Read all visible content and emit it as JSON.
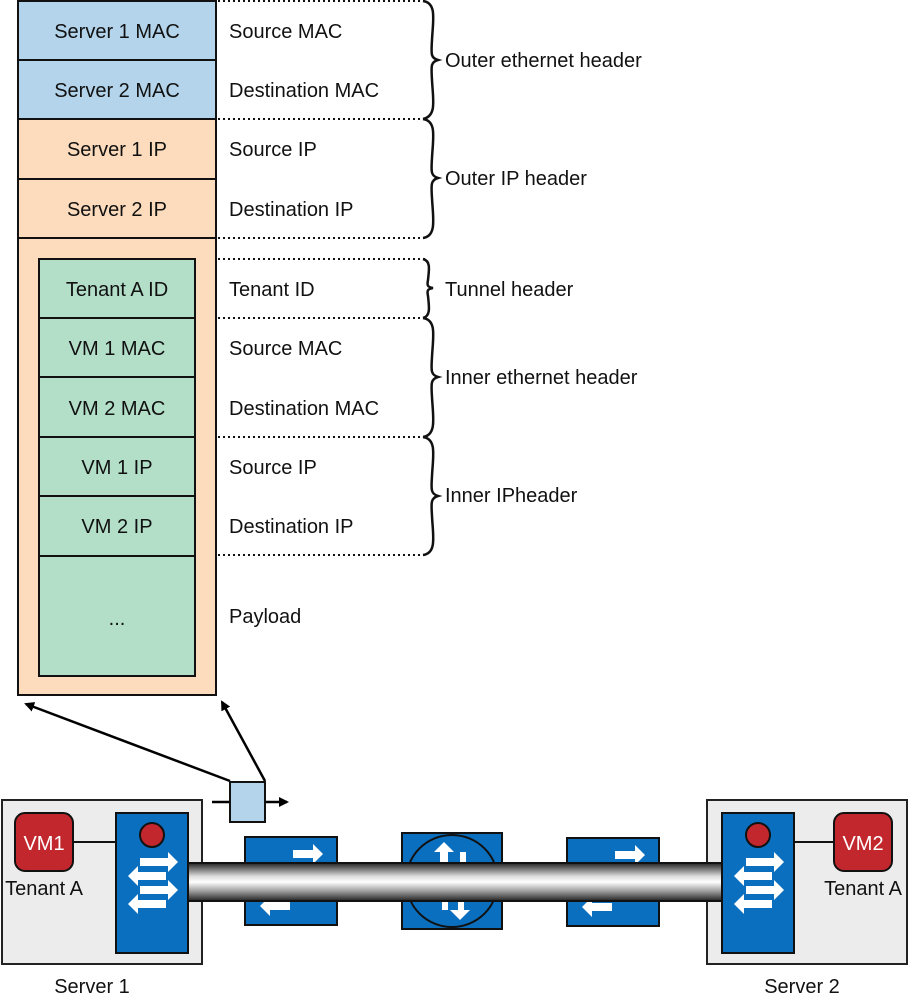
{
  "colors": {
    "outer_mac": "#b3d4ea",
    "outer_ip": "#fcdcbc",
    "inner": "#b3dfc9",
    "vm": "#c1272d",
    "switch_blue": "#0a6fbf",
    "server_bg": "#ececec"
  },
  "packet": {
    "outer_fields": [
      {
        "value": "Server 1 MAC",
        "field": "Source MAC"
      },
      {
        "value": "Server 2 MAC",
        "field": "Destination MAC"
      },
      {
        "value": "Server 1 IP",
        "field": "Source IP"
      },
      {
        "value": "Server 2 IP",
        "field": "Destination IP"
      }
    ],
    "inner_fields": [
      {
        "value": "Tenant A ID",
        "field": "Tenant ID"
      },
      {
        "value": "VM 1 MAC",
        "field": "Source MAC"
      },
      {
        "value": "VM 2 MAC",
        "field": "Destination MAC"
      },
      {
        "value": "VM 1 IP",
        "field": "Source IP"
      },
      {
        "value": "VM 2 IP",
        "field": "Destination IP"
      },
      {
        "value": "...",
        "field": "Payload"
      }
    ],
    "groups": [
      {
        "label": "Outer ethernet header"
      },
      {
        "label": "Outer IP header"
      },
      {
        "label": "Tunnel header"
      },
      {
        "label": "Inner ethernet header"
      },
      {
        "label": "Inner IPheader"
      }
    ]
  },
  "network": {
    "server1": {
      "label": "Server 1",
      "vm": "VM1",
      "tenant": "Tenant A"
    },
    "server2": {
      "label": "Server 2",
      "vm": "VM2",
      "tenant": "Tenant A"
    }
  }
}
